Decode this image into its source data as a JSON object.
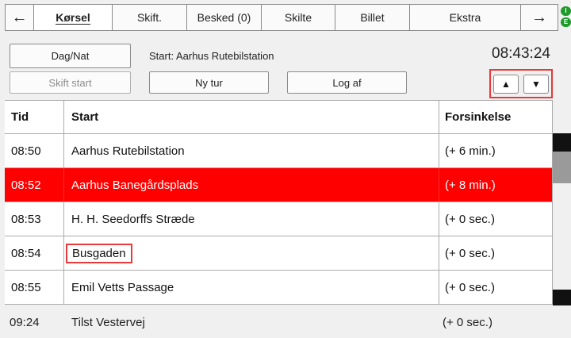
{
  "tabs": [
    {
      "label": "←",
      "name": "back-arrow-tab",
      "width": 36,
      "kind": "nav"
    },
    {
      "label": "Kørsel",
      "name": "tab-korsel",
      "width": 99,
      "kind": "active"
    },
    {
      "label": "Skift.",
      "name": "tab-skift",
      "width": 94,
      "kind": "normal"
    },
    {
      "label": "Besked (0)",
      "name": "tab-besked",
      "width": 94,
      "kind": "normal"
    },
    {
      "label": "Skilte",
      "name": "tab-skilte",
      "width": 93,
      "kind": "normal"
    },
    {
      "label": "Billet",
      "name": "tab-billet",
      "width": 94,
      "kind": "normal"
    },
    {
      "label": "Ekstra",
      "name": "tab-ekstra",
      "width": 140,
      "kind": "normal"
    },
    {
      "label": "→",
      "name": "forward-arrow-tab",
      "width": 48,
      "kind": "nav"
    }
  ],
  "indicator": {
    "top": "I",
    "bottom": "E",
    "color": "#1d9b2a"
  },
  "toolbar": {
    "daynight_label": "Dag/Nat",
    "start_label": "Start: Aarhus Rutebilstation",
    "clock": "08:43:24",
    "change_start_label": "Skift start",
    "new_trip_label": "Ny tur",
    "logout_label": "Log af"
  },
  "table": {
    "headers": {
      "time": "Tid",
      "start": "Start",
      "delay": "Forsinkelse"
    },
    "rows": [
      {
        "time": "08:50",
        "start": "Aarhus Rutebilstation",
        "delay": "(+ 6 min.)"
      },
      {
        "time": "08:52",
        "start": "Aarhus Banegårdsplads",
        "delay": "(+ 8 min.)"
      },
      {
        "time": "08:53",
        "start": "H. H. Seedorffs Stræde",
        "delay": "(+ 0 sec.)"
      },
      {
        "time": "08:54",
        "start": "Busgaden",
        "delay": "(+ 0 sec.)"
      },
      {
        "time": "08:55",
        "start": "Emil Vetts Passage",
        "delay": "(+ 0 sec.)"
      }
    ],
    "overflow_row": {
      "time": "09:24",
      "start": "Tilst Vestervej",
      "delay": "(+ 0 sec.)"
    }
  },
  "colors": {
    "selected_row": "#ff0000",
    "highlight": "#e83a3a"
  }
}
